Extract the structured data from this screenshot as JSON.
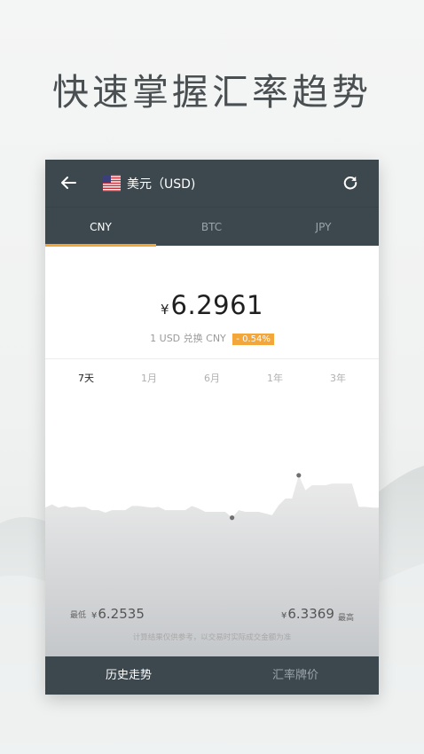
{
  "headline": "快速掌握汇率趋势",
  "topbar": {
    "currency_title": "美元（USD)",
    "back_icon": "back-arrow-icon",
    "flag_icon": "us-flag-icon",
    "refresh_icon": "refresh-icon"
  },
  "tabs": [
    {
      "label": "CNY",
      "active": true
    },
    {
      "label": "BTC",
      "active": false
    },
    {
      "label": "JPY",
      "active": false
    }
  ],
  "rate": {
    "currency_symbol": "¥",
    "value": "6.2961",
    "subtitle": "1 USD 兑换 CNY",
    "change": "- 0.54%"
  },
  "periods": [
    {
      "label": "7天",
      "active": true
    },
    {
      "label": "1月",
      "active": false
    },
    {
      "label": "6月",
      "active": false
    },
    {
      "label": "1年",
      "active": false
    },
    {
      "label": "3年",
      "active": false
    }
  ],
  "stats": {
    "min_label": "最低",
    "min_value": "6.2535",
    "max_label": "最高",
    "max_value": "6.3369",
    "currency_symbol": "¥"
  },
  "disclaimer": "计算结果仅供参考，以交易时实际成交金额为准",
  "bottom_nav": [
    {
      "label": "历史走势",
      "active": true
    },
    {
      "label": "汇率牌价",
      "active": false
    }
  ],
  "colors": {
    "bar": "#3c484e",
    "accent": "#f0a536",
    "badge": "#f3a73a"
  },
  "chart_data": {
    "type": "area",
    "x": [
      0,
      2,
      4,
      6,
      8,
      10,
      12,
      14,
      16,
      18,
      20,
      22,
      24,
      26,
      28,
      30,
      32,
      34,
      36,
      38,
      40,
      42,
      44,
      46,
      48,
      50,
      52,
      54,
      56,
      58,
      60,
      62,
      64,
      66,
      68,
      70,
      72,
      74,
      76,
      78,
      80,
      82,
      84,
      86,
      88,
      90,
      92,
      94,
      96,
      98,
      100
    ],
    "values": [
      6.2905,
      6.2925,
      6.2905,
      6.2915,
      6.2905,
      6.291,
      6.291,
      6.289,
      6.289,
      6.2875,
      6.289,
      6.289,
      6.289,
      6.2915,
      6.2915,
      6.291,
      6.2905,
      6.291,
      6.289,
      6.289,
      6.289,
      6.289,
      6.2915,
      6.29,
      6.288,
      6.288,
      6.288,
      6.288,
      6.2845,
      6.289,
      6.288,
      6.288,
      6.288,
      6.287,
      6.286,
      6.292,
      6.296,
      6.296,
      6.31,
      6.301,
      6.304,
      6.304,
      6.304,
      6.305,
      6.305,
      6.305,
      6.305,
      6.291,
      6.291,
      6.2905,
      6.2905
    ],
    "markers": [
      {
        "label": "min",
        "value": 6.2535
      },
      {
        "label": "max",
        "value": 6.3369
      }
    ],
    "y_range": [
      6.2,
      6.36
    ],
    "grid": false
  }
}
